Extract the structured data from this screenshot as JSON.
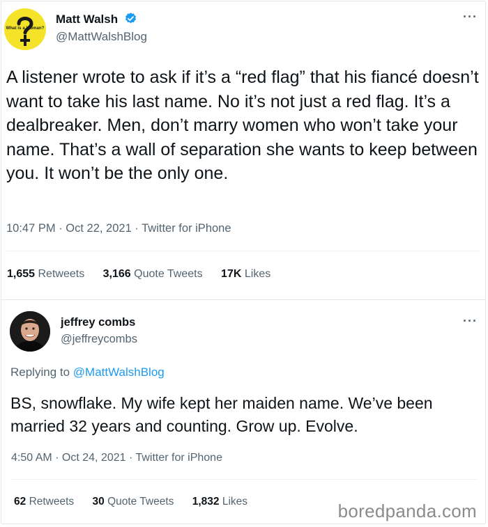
{
  "tweet": {
    "author_name": "Matt Walsh",
    "author_handle": "@MattWalshBlog",
    "avatar_text": "What is a Woman?",
    "body": "A listener wrote to ask if it’s a “red flag” that his fiancé doesn’t want to take his last name. No it’s not just a red flag. It’s a dealbreaker. Men, don’t marry women who won’t take your name. That’s a wall of separation she wants to keep between you. It won’t be the only one.",
    "timestamp": "10:47 PM · Oct 22, 2021 · Twitter for iPhone",
    "stats": {
      "retweets_count": "1,655",
      "retweets_label": "Retweets",
      "quotes_count": "3,166",
      "quotes_label": "Quote Tweets",
      "likes_count": "17K",
      "likes_label": "Likes"
    },
    "more_label": "···"
  },
  "reply": {
    "author_name": "jeffrey combs",
    "author_handle": "@jeffreycombs",
    "replying_prefix": "Replying to ",
    "replying_handle": "@MattWalshBlog",
    "body": "BS, snowflake. My wife kept her maiden name. We’ve been married 32 years and counting. Grow up. Evolve.",
    "timestamp": "4:50 AM · Oct 24, 2021 · Twitter for iPhone",
    "stats": {
      "retweets_count": "62",
      "retweets_label": "Retweets",
      "quotes_count": "30",
      "quotes_label": "Quote Tweets",
      "likes_count": "1,832",
      "likes_label": "Likes"
    },
    "more_label": "···"
  },
  "watermark": "boredpanda.com",
  "colors": {
    "verified_blue": "#1d9bf0",
    "link_blue": "#1d9bf0",
    "secondary_text": "#536471",
    "avatar_yellow": "#f5e32a"
  }
}
